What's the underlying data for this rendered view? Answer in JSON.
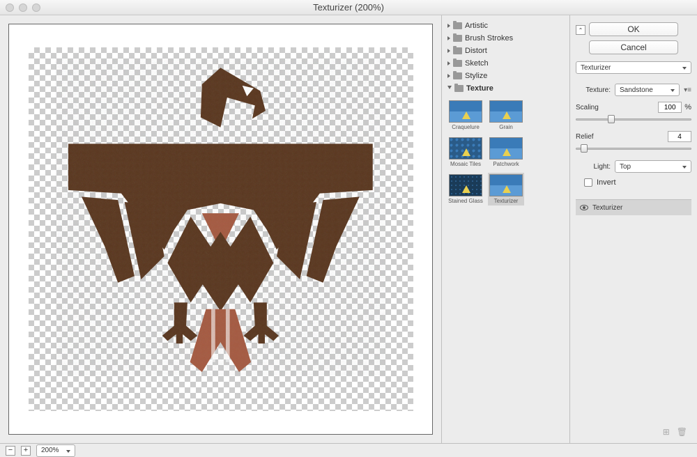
{
  "window": {
    "title": "Texturizer (200%)"
  },
  "zoom": {
    "level": "200%"
  },
  "categories": [
    {
      "name": "Artistic",
      "open": false
    },
    {
      "name": "Brush Strokes",
      "open": false
    },
    {
      "name": "Distort",
      "open": false
    },
    {
      "name": "Sketch",
      "open": false
    },
    {
      "name": "Stylize",
      "open": false
    },
    {
      "name": "Texture",
      "open": true
    }
  ],
  "thumbs": [
    {
      "label": "Craquelure",
      "sel": false
    },
    {
      "label": "Grain",
      "sel": false
    },
    {
      "label": "Mosaic Tiles",
      "sel": false
    },
    {
      "label": "Patchwork",
      "sel": false
    },
    {
      "label": "Stained Glass",
      "sel": false
    },
    {
      "label": "Texturizer",
      "sel": true
    }
  ],
  "buttons": {
    "ok": "OK",
    "cancel": "Cancel"
  },
  "filter": {
    "name": "Texturizer",
    "texture_label": "Texture:",
    "texture_value": "Sandstone",
    "scaling_label": "Scaling",
    "scaling_value": "100",
    "scaling_unit": "%",
    "relief_label": "Relief",
    "relief_value": "4",
    "light_label": "Light:",
    "light_value": "Top",
    "invert_label": "Invert"
  },
  "layers": {
    "item": "Texturizer"
  },
  "icons": {
    "collapse": "⌃",
    "new": "⊞",
    "trash": "🗑",
    "minus": "−",
    "plus": "+"
  }
}
